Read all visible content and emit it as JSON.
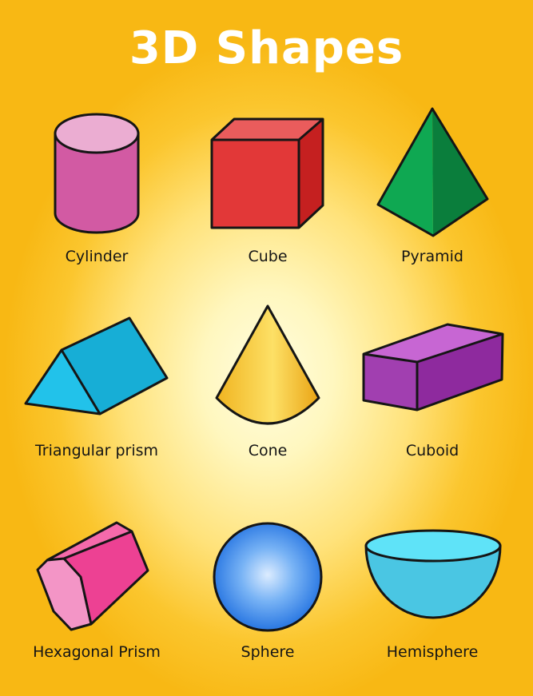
{
  "title": "3D Shapes",
  "shapes": [
    {
      "label": "Cylinder",
      "icon": "cylinder-icon",
      "color": "#d95aa8"
    },
    {
      "label": "Cube",
      "icon": "cube-icon",
      "color": "#e33838"
    },
    {
      "label": "Pyramid",
      "icon": "pyramid-icon",
      "color": "#0e9a4c"
    },
    {
      "label": "Triangular prism",
      "icon": "triangular-prism-icon",
      "color": "#1fb7de"
    },
    {
      "label": "Cone",
      "icon": "cone-icon",
      "color": "#f5c530"
    },
    {
      "label": "Cuboid",
      "icon": "cuboid-icon",
      "color": "#a53ab3"
    },
    {
      "label": "Hexagonal Prism",
      "icon": "hexagonal-prism-icon",
      "color": "#ee3e8e"
    },
    {
      "label": "Sphere",
      "icon": "sphere-icon",
      "color": "#2d7fe6"
    },
    {
      "label": "Hemisphere",
      "icon": "hemisphere-icon",
      "color": "#4ac6e3"
    }
  ],
  "colors": {
    "background_center": "#fffde0",
    "background_edge": "#f8b814",
    "title": "#ffffff",
    "outline": "#151515"
  }
}
